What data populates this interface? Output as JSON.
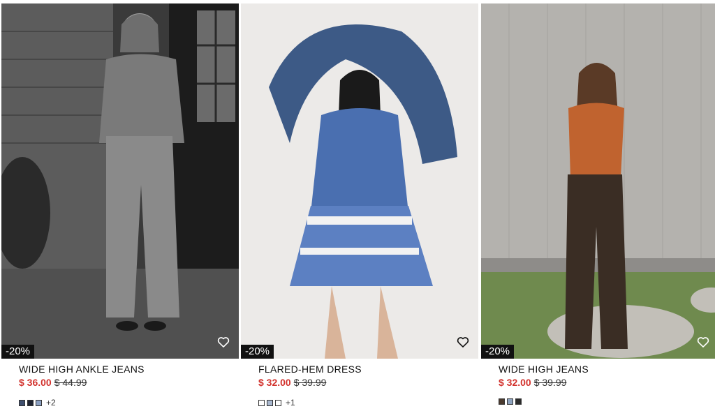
{
  "products": [
    {
      "name": "WIDE HIGH ANKLE JEANS",
      "price": "$ 36.00",
      "old_price": "$ 44.99",
      "badge": "-20%",
      "swatch_colors": [
        "#3f4f6e",
        "#1d2230",
        "#8ba0c2"
      ],
      "more_colors": "+2",
      "wishlist_icon": "heart-outline-icon"
    },
    {
      "name": "FLARED-HEM DRESS",
      "price": "$ 32.00",
      "old_price": "$ 39.99",
      "badge": "-20%",
      "swatch_colors": [
        "#ffffff",
        "#a9b8cf",
        "#ffffff"
      ],
      "more_colors": "+1",
      "wishlist_icon": "heart-outline-icon"
    },
    {
      "name": "WIDE HIGH JEANS",
      "price": "$ 32.00",
      "old_price": "$ 39.99",
      "badge": "-20%",
      "swatch_colors": [
        "#4a3a2e",
        "#8ea3bf",
        "#2b2b2b"
      ],
      "more_colors": "",
      "wishlist_icon": "heart-outline-icon"
    }
  ],
  "colors": {
    "sale_price": "#d2322d",
    "badge_bg": "#111111"
  }
}
